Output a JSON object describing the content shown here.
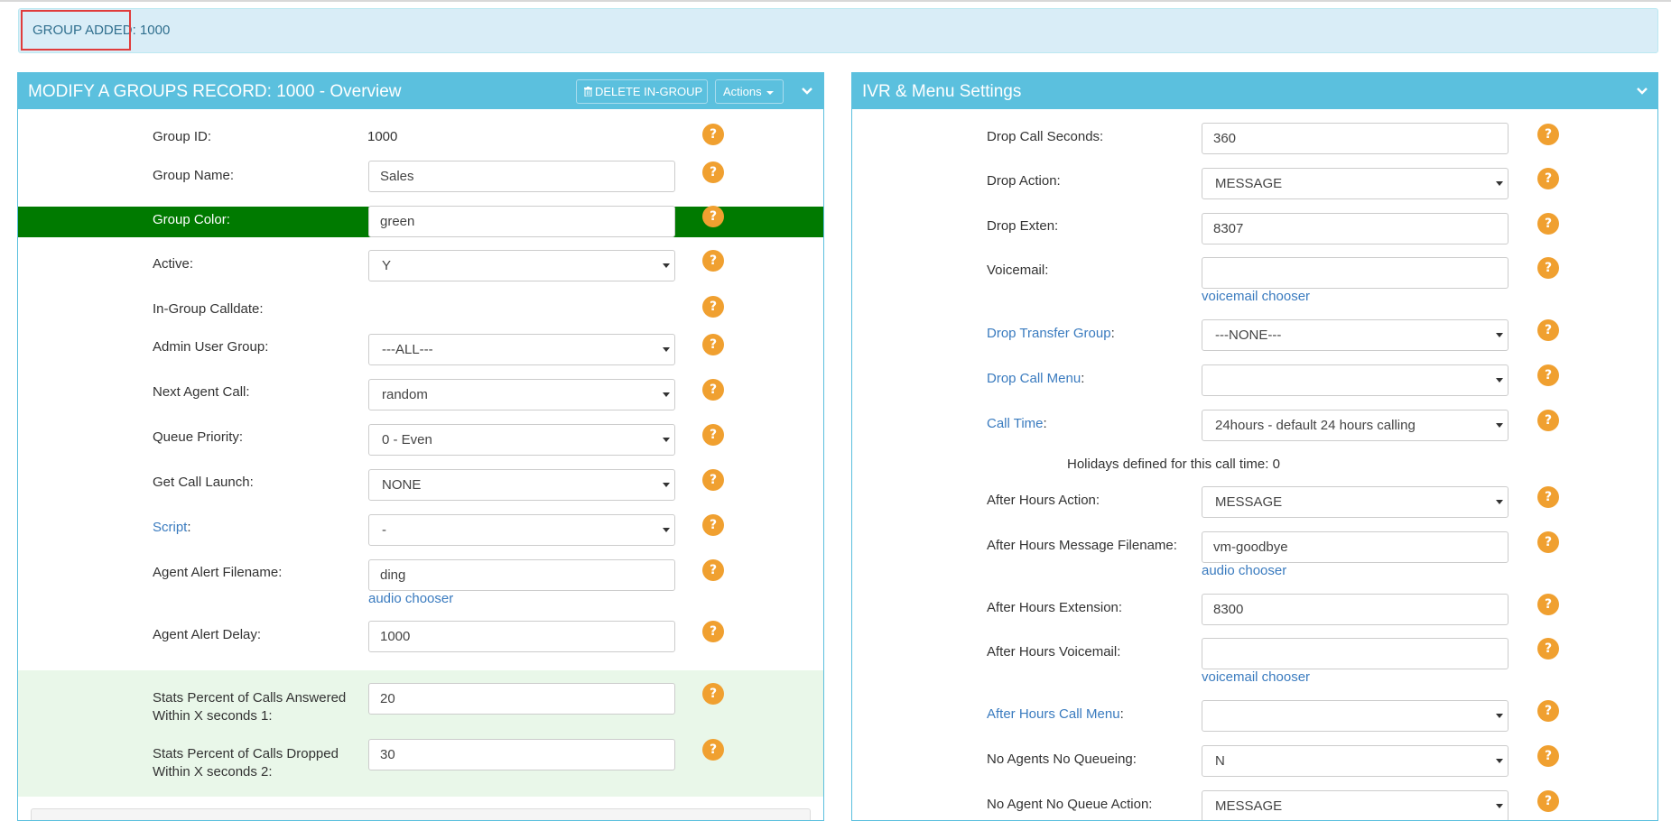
{
  "alert": {
    "text": "GROUP ADDED: 1000"
  },
  "left_panel": {
    "title": "MODIFY A GROUPS RECORD: 1000 - Overview",
    "delete_button": "DELETE IN-GROUP",
    "actions_button": "Actions",
    "group_id": {
      "label": "Group ID:",
      "value": "1000"
    },
    "group_name": {
      "label": "Group Name:",
      "value": "Sales"
    },
    "group_color": {
      "label": "Group Color:",
      "value": "green"
    },
    "active": {
      "label": "Active:",
      "value": "Y"
    },
    "in_group_calldate": {
      "label": "In-Group Calldate:"
    },
    "admin_user_group": {
      "label": "Admin User Group:",
      "value": "---ALL---"
    },
    "next_agent_call": {
      "label": "Next Agent Call:",
      "value": "random"
    },
    "queue_priority": {
      "label": "Queue Priority:",
      "value": "0 - Even"
    },
    "get_call_launch": {
      "label": "Get Call Launch:",
      "value": "NONE"
    },
    "script": {
      "label": "Script",
      "label_suffix": ":",
      "value": "-"
    },
    "agent_alert_filename": {
      "label": "Agent Alert Filename:",
      "value": "ding",
      "chooser": "audio chooser"
    },
    "agent_alert_delay": {
      "label": "Agent Alert Delay:",
      "value": "1000"
    },
    "stats_answered": {
      "label_line1": "Stats Percent of Calls Answered",
      "label_line2": "Within X seconds 1:",
      "value": "20"
    },
    "stats_dropped": {
      "label_line1": "Stats Percent of Calls Dropped",
      "label_line2": "Within X seconds 2:",
      "value": "30"
    }
  },
  "right_panel": {
    "title": "IVR & Menu Settings",
    "drop_call_seconds": {
      "label": "Drop Call Seconds:",
      "value": "360"
    },
    "drop_action": {
      "label": "Drop Action:",
      "value": "MESSAGE"
    },
    "drop_exten": {
      "label": "Drop Exten:",
      "value": "8307"
    },
    "voicemail": {
      "label": "Voicemail:",
      "value": "",
      "chooser": "voicemail chooser"
    },
    "drop_transfer_group": {
      "label": "Drop Transfer Group",
      "label_suffix": ":",
      "value": "---NONE---"
    },
    "drop_call_menu": {
      "label": "Drop Call Menu",
      "label_suffix": ":",
      "value": ""
    },
    "call_time": {
      "label": "Call Time",
      "label_suffix": ":",
      "value": "24hours - default 24 hours calling"
    },
    "holidays_note": "Holidays defined for this call time: 0",
    "after_hours_action": {
      "label": "After Hours Action:",
      "value": "MESSAGE"
    },
    "after_hours_message_filename": {
      "label": "After Hours Message Filename:",
      "value": "vm-goodbye",
      "chooser": "audio chooser"
    },
    "after_hours_extension": {
      "label": "After Hours Extension:",
      "value": "8300"
    },
    "after_hours_voicemail": {
      "label": "After Hours Voicemail:",
      "value": "",
      "chooser": "voicemail chooser"
    },
    "after_hours_call_menu": {
      "label": "After Hours Call Menu",
      "label_suffix": ":",
      "value": ""
    },
    "no_agents_no_queueing": {
      "label": "No Agents No Queueing:",
      "value": "N"
    },
    "no_agent_no_queue_action": {
      "label": "No Agent No Queue Action:",
      "value": "MESSAGE"
    }
  },
  "help_glyph": "?",
  "colors": {
    "panel_header": "#5bc0de",
    "alert_bg": "#d9edf7",
    "alert_text": "#31708f",
    "group_color_band": "#007a00",
    "stats_band": "#e9f7e9",
    "help_icon": "#f0a030",
    "link": "#3a7bbf",
    "highlight_box": "#e03c3c"
  },
  "icons": [
    "trash-icon",
    "caret-down-icon",
    "chevron-down-icon",
    "help-icon",
    "select-arrow-icon"
  ]
}
